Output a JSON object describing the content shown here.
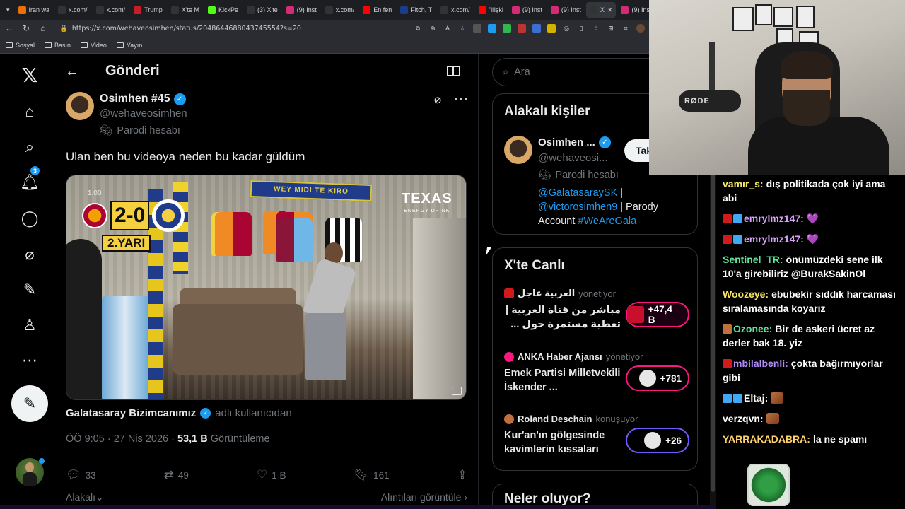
{
  "browser": {
    "tabs": [
      {
        "label": "Iran wa",
        "color": "#e8710a",
        "active": false
      },
      {
        "label": "x.com/",
        "color": "#333333",
        "active": false
      },
      {
        "label": "x.com/",
        "color": "#333333",
        "active": false
      },
      {
        "label": "Trump",
        "color": "#c81d25",
        "active": false
      },
      {
        "label": "X'te M",
        "color": "#333333",
        "active": false
      },
      {
        "label": "KickPe",
        "color": "#53fc18",
        "active": false
      },
      {
        "label": "(3) X'te",
        "color": "#333333",
        "active": false
      },
      {
        "label": "(9) Inst",
        "color": "#d62976",
        "active": false
      },
      {
        "label": "x.com/",
        "color": "#333333",
        "active": false
      },
      {
        "label": "En fen",
        "color": "#ff0000",
        "active": false
      },
      {
        "label": "Fitch, T",
        "color": "#1a3c8c",
        "active": false
      },
      {
        "label": "x.com/",
        "color": "#333333",
        "active": false
      },
      {
        "label": "\"ilişki",
        "color": "#ff0000",
        "active": false
      },
      {
        "label": "(9) Inst",
        "color": "#d62976",
        "active": false
      },
      {
        "label": "(9) Inst",
        "color": "#d62976",
        "active": false
      },
      {
        "label": "X",
        "color": "#333333",
        "active": true
      },
      {
        "label": "(9) Inst",
        "color": "#d62976",
        "active": false
      }
    ],
    "url": "https://x.com/wehaveosimhen/status/2048644688043745554?s=20",
    "bookmarks": [
      "Sosyal",
      "Basın",
      "Video",
      "Yayın"
    ]
  },
  "sidebar": {
    "notif_count": "3",
    "items": [
      "x-logo",
      "home",
      "search",
      "notifications",
      "messages",
      "grok",
      "lists",
      "profile",
      "more"
    ]
  },
  "post": {
    "header_title": "Gönderi",
    "author_name": "Osimhen #45",
    "author_handle": "@wehaveosimhen",
    "parody_label": "Parodi hesabı",
    "text": "Ulan ben bu videoya neden bu kadar güldüm",
    "media": {
      "score": "2-0",
      "half": "2.YARI",
      "timer": "1.00",
      "scarf_text": "WEY MIDI TE KIRO",
      "brand": "TEXAS",
      "brand_sub": "ENERGY DRINK"
    },
    "attribution_name": "Galatasaray Bizimcanımız",
    "attribution_suffix": "adlı kullanıcıdan",
    "time": "ÖÖ 9:05 · 27 Nis 2026 · ",
    "views": "53,1 B",
    "views_label": "Görüntüleme",
    "replies": "33",
    "reposts": "49",
    "likes": "1 B",
    "bookmarks": "161",
    "related_tab": "Alakalı",
    "quotes_tab": "Alıntıları görüntüle"
  },
  "right": {
    "search_placeholder": "Ara",
    "related": {
      "title": "Alakalı kişiler",
      "name": "Osimhen ...",
      "handle": "@wehaveosi...",
      "follow": "Takip et",
      "parody": "Parodi hesabı",
      "bio_link1": "@GalatasaraySK",
      "bio_sep": " | ",
      "bio_link2": "@victorosimhen9",
      "bio_text": " | Parody Account ",
      "bio_tag": "#WeAreGala"
    },
    "live": {
      "title": "X'te Canlı",
      "items": [
        {
          "source": "العربية عاجل",
          "role": "yönetiyor",
          "title": "مباشر من قناة العربية | تغطية مستمرة حول ...",
          "count": "+47,4 B",
          "pill_color": "#f91880"
        },
        {
          "source": "ANKA Haber Ajansı",
          "role": "yönetiyor",
          "title": "Emek Partisi Milletvekili İskender ...",
          "count": "+781",
          "pill_color": "#f91880"
        },
        {
          "source": "Roland Deschain",
          "role": "konuşuyor",
          "title": "Kur'an'ın gölgesinde kavimlerin kıssaları",
          "count": "+26",
          "pill_color": "#7856ff"
        }
      ]
    },
    "whats_happening": "Neler oluyor?"
  },
  "chat": {
    "messages": [
      {
        "user": "vamır_s:",
        "color": "#f5e663",
        "text": "dış politikada çok iyi ama abi",
        "badges": []
      },
      {
        "user": "emrylmz147:",
        "color": "#d8a0ff",
        "text": "💜",
        "badges": [
          "#d11b1b",
          "#3fa9f5"
        ]
      },
      {
        "user": "emrylmz147:",
        "color": "#d8a0ff",
        "text": "💜",
        "badges": [
          "#d11b1b",
          "#3fa9f5"
        ]
      },
      {
        "user": "Sentinel_TR:",
        "color": "#5de39a",
        "text": "önümüzdeki sene ilk 10'a girebiliriz @BurakSakinOl",
        "badges": []
      },
      {
        "user": "Woozeye:",
        "color": "#f5e663",
        "text": "ebubekir sıddık harcaması sıralamasında koyarız",
        "badges": []
      },
      {
        "user": "Ozonee:",
        "color": "#5de39a",
        "text": "Bir de askeri ücret az derler bak 18. yiz",
        "badges": [
          "#c0703f"
        ]
      },
      {
        "user": "mbilalbenli:",
        "color": "#b58cff",
        "text": "çokta bağırmıyorlar gibi",
        "badges": [
          "#d11b1b"
        ]
      },
      {
        "user": "Eltaj:",
        "color": "#ffffff",
        "text": "",
        "badges": [
          "#3fa9f5",
          "#3fa9f5"
        ],
        "emote": true
      },
      {
        "user": "verzqvn:",
        "color": "#ffffff",
        "text": "",
        "badges": [],
        "emote": true
      },
      {
        "user": "YARRAKADABRA:",
        "color": "#ffd36b",
        "text": "la ne spamı",
        "badges": []
      }
    ]
  },
  "colors": {
    "accent": "#1d9bf0",
    "bg": "#000000",
    "muted": "#71767b",
    "border": "#2f3336"
  }
}
